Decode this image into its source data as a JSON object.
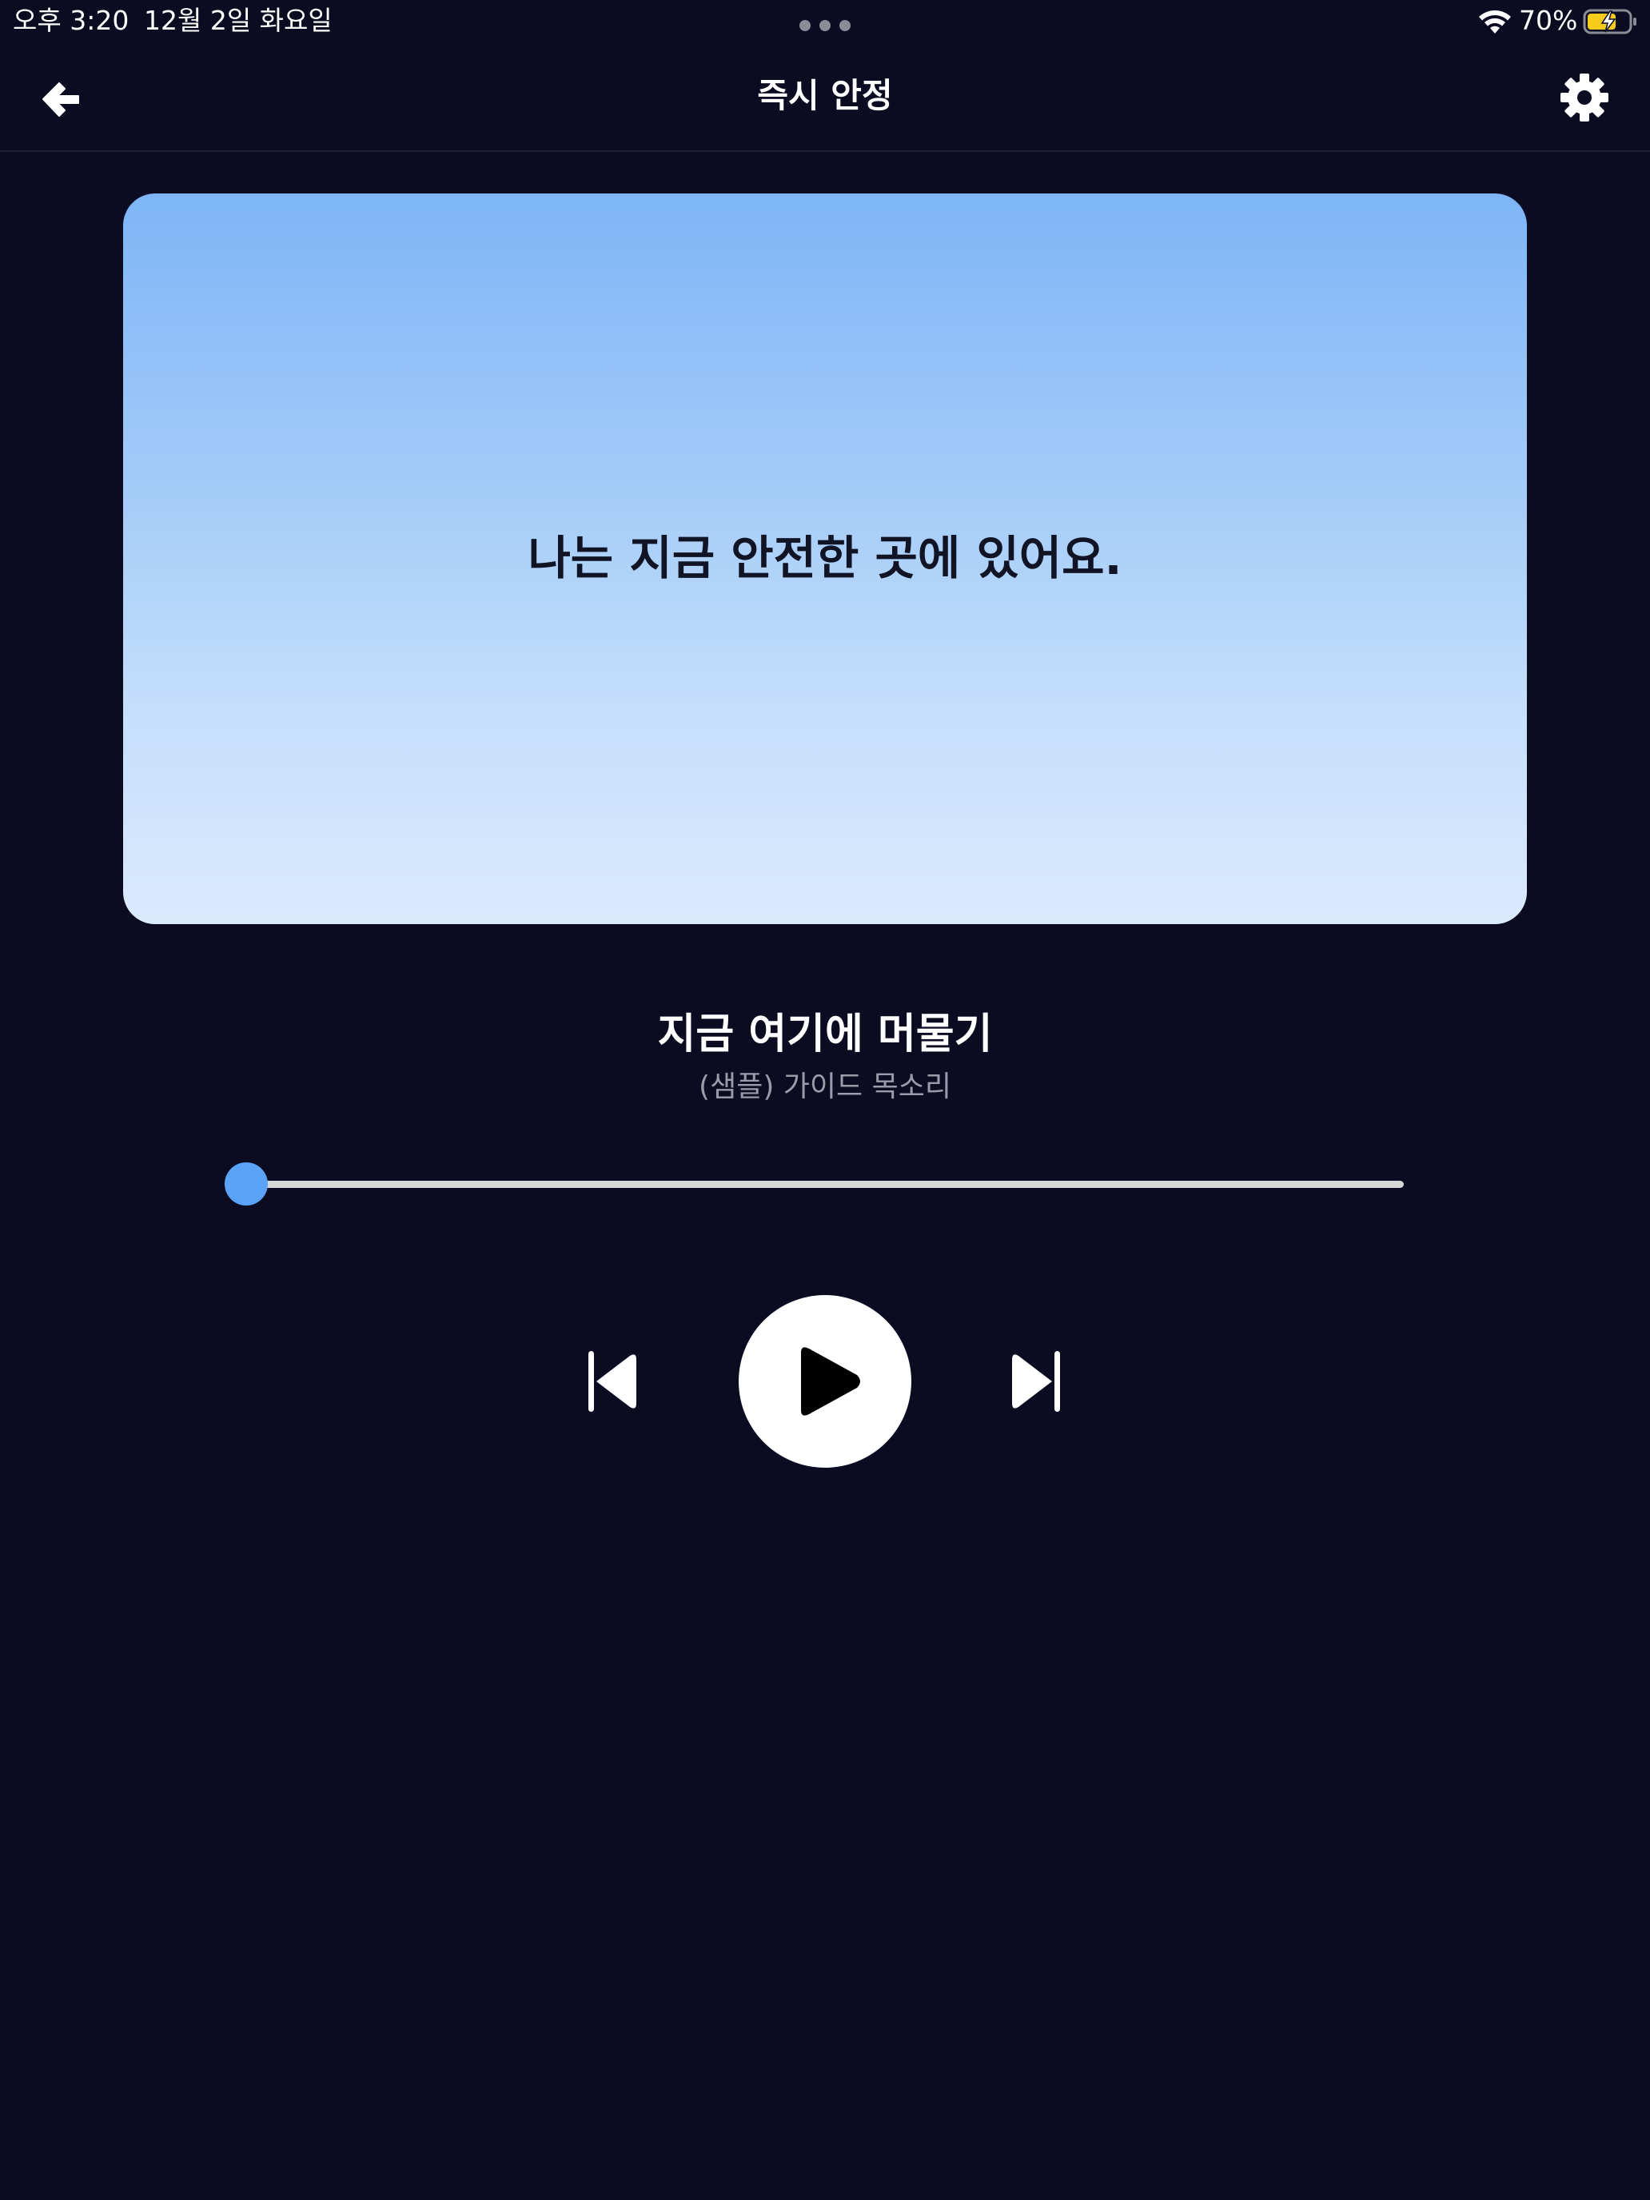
{
  "status_bar": {
    "time": "오후 3:20",
    "date": "12월 2일 화요일",
    "battery_percent": "70%",
    "wifi_icon": "wifi-icon",
    "battery_icon": "battery-charging-icon",
    "battery_level": 0.7,
    "battery_color": "#f5cc1c"
  },
  "nav": {
    "title": "즉시 안정",
    "back_icon": "arrow-left-icon",
    "settings_icon": "gear-icon"
  },
  "card": {
    "affirmation": "나는 지금 안전한 곳에 있어요."
  },
  "track": {
    "title": "지금 여기에 머물기",
    "subtitle": "(샘플) 가이드 목소리"
  },
  "player": {
    "progress": 0,
    "accent_color": "#5aa3f6",
    "play_icon": "play-icon",
    "skip_back_icon": "skip-back-icon",
    "skip_forward_icon": "skip-forward-icon"
  },
  "colors": {
    "background": "#0b0c21",
    "card_gradient_top": "#7db5f7",
    "card_gradient_bottom": "#dbeafd"
  }
}
